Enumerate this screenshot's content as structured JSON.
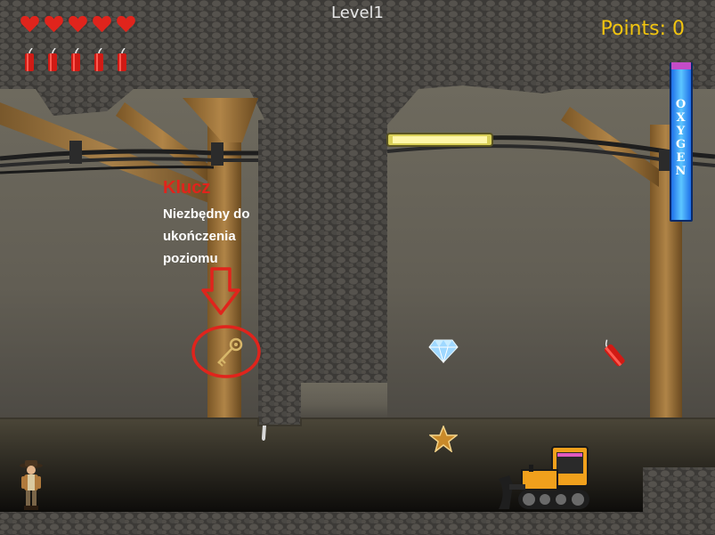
{
  "hud": {
    "level_label": "Level1",
    "points_label": "Points: 0",
    "hearts_count": 5,
    "dynamite_count": 5,
    "oxygen_label": [
      "O",
      "X",
      "Y",
      "G",
      "E",
      "N"
    ],
    "oxygen_level": 0.96
  },
  "hint": {
    "title": "Klucz",
    "body": "Niezbędny do ukończenia poziomu"
  },
  "colors": {
    "hud_points": "#f1c40f",
    "hint_title": "#e0241c",
    "hint_circle": "#e0241c",
    "heart": "#e0241c",
    "oxygen_bar": "#3aa0ff",
    "lamp_light": "#ffe98a"
  },
  "icons": [
    "heart-icon",
    "dynamite-icon",
    "key-icon",
    "diamond-icon",
    "star-icon",
    "bulldozer",
    "miner-player",
    "down-arrow-icon"
  ]
}
